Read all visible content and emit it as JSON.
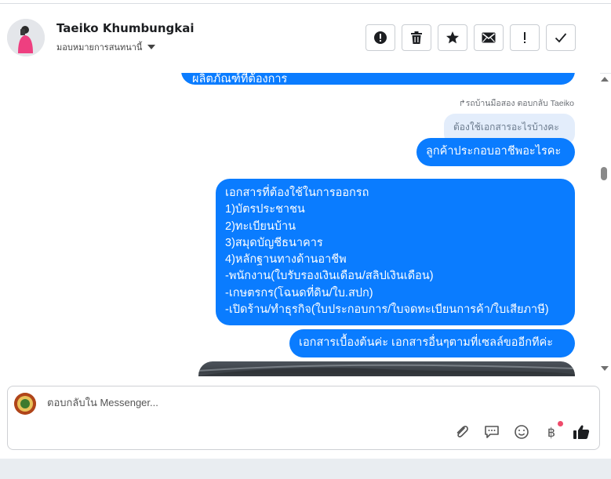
{
  "contact": {
    "name": "Taeiko Khumbungkai",
    "assign_label": "มอบหมายการสนทนานี้"
  },
  "header_actions": [
    {
      "icon": "alert-circle-icon",
      "label": "Mark as spam"
    },
    {
      "icon": "trash-icon",
      "label": "Delete"
    },
    {
      "icon": "star-icon",
      "label": "Star"
    },
    {
      "icon": "envelope-icon",
      "label": "Mark as unread"
    },
    {
      "icon": "exclamation-icon",
      "label": "Follow up"
    },
    {
      "icon": "checkmark-icon",
      "label": "Done"
    }
  ],
  "messages": {
    "partial_top_text": "ผลิตภัณฑ์ที่ต้องการ",
    "reply_tag": "รถบ้านมือสอง ตอบกลับ Taeiko",
    "quoted_text": "ต้องใช้เอกสารอะไรบ้างคะ",
    "bubble_occupation": "ลูกค้าประกอบอาชีพอะไรคะ",
    "documents": [
      "เอกสารที่ต้องใช้ในการออกรถ",
      "1)บัตรประชาชน",
      "2)ทะเบียนบ้าน",
      "3)สมุดบัญชีธนาคาร",
      "4)หลักฐานทางด้านอาชีพ",
      "-พนักงาน(ใบรับรองเงินเดือน/สลิปเงินเดือน)",
      "-เกษตรกร(โฉนดที่ดิน/ใบ.สปก)",
      "-เปิดร้าน/ทำธุรกิจ(ใบประกอบการ/ใบจดทะเบียนการค้า/ใบเสียภาษี)"
    ],
    "bubble_basic_docs": "เอกสารเบื้องต้นค่ะ เอกสารอื่นๆตามที่เซลล์ขออีกทีค่ะ"
  },
  "composer": {
    "placeholder": "ตอบกลับใน Messenger...",
    "tools": [
      "paperclip-icon",
      "saved-reply-icon",
      "emoji-icon",
      "baht-payment-icon",
      "thumbs-up-icon"
    ],
    "baht_symbol": "฿"
  },
  "colors": {
    "bubble": "#0a7cff",
    "quoted_bubble": "#e3edfb",
    "notification_dot": "#ef4b6b"
  }
}
